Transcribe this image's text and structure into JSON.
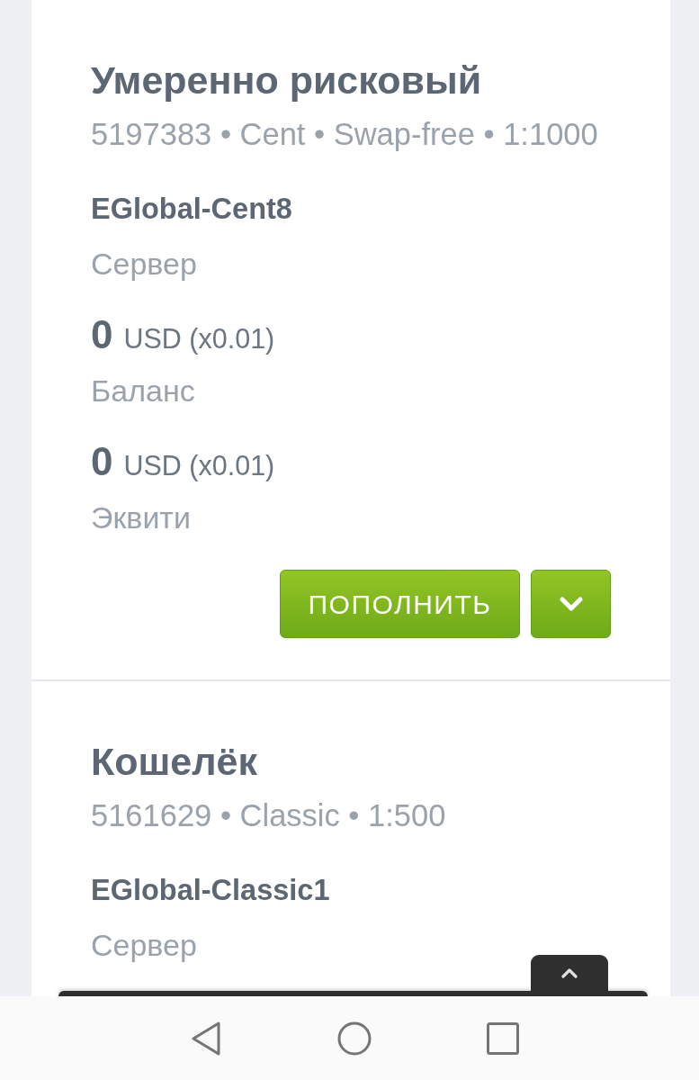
{
  "accounts": [
    {
      "title": "Умеренно рисковый",
      "details": "5197383 • Cent • Swap-free • 1:1000",
      "server": "EGlobal-Cent8",
      "server_label": "Сервер",
      "figures": [
        {
          "amount": "0",
          "currency": "USD (x0.01)",
          "label": "Баланс"
        },
        {
          "amount": "0",
          "currency": "USD (x0.01)",
          "label": "Эквити"
        }
      ],
      "deposit_button": "ПОПОЛНИТЬ"
    },
    {
      "title": "Кошелёк",
      "details": "5161629 • Classic • 1:500",
      "server": "EGlobal-Classic1",
      "server_label": "Сервер"
    }
  ]
}
